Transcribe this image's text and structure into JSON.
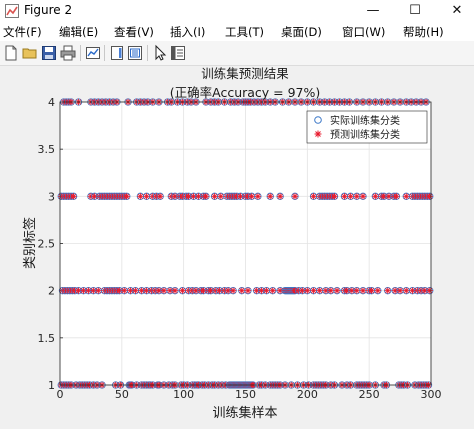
{
  "window": {
    "title": "Figure 2",
    "minimize_icon": "minimize-icon",
    "maximize_icon": "maximize-icon",
    "close_icon": "close-icon"
  },
  "menu": {
    "items": [
      {
        "label": "文件(F)"
      },
      {
        "label": "编辑(E)"
      },
      {
        "label": "查看(V)"
      },
      {
        "label": "插入(I)"
      },
      {
        "label": "工具(T)"
      },
      {
        "label": "桌面(D)"
      },
      {
        "label": "窗口(W)"
      },
      {
        "label": "帮助(H)"
      }
    ]
  },
  "toolbar": {
    "icons": [
      "new-figure-icon",
      "open-file-icon",
      "save-icon",
      "print-icon",
      "link-plot-icon",
      "colorbar-icon",
      "legend-icon",
      "pointer-icon",
      "property-editor-icon"
    ]
  },
  "colors": {
    "actual": "#3c78c8",
    "predicted": "#e8192c"
  },
  "chart_data": {
    "type": "scatter",
    "title": "训练集预测结果",
    "subtitle": "(正确率Accuracy = 97%)",
    "xlabel": "训练集样本",
    "ylabel": "类别标签",
    "xlim": [
      0,
      300
    ],
    "ylim": [
      1,
      4
    ],
    "xticks": [
      0,
      50,
      100,
      150,
      200,
      250,
      300
    ],
    "yticks": [
      1,
      1.5,
      2,
      2.5,
      3,
      3.5,
      4
    ],
    "grid": true,
    "legend_position": "top-right",
    "series": [
      {
        "name": "实际训练集分类",
        "marker": "o"
      },
      {
        "name": "预测训练集分类",
        "marker": "*"
      }
    ],
    "points": [
      {
        "x": [
          1,
          3,
          5,
          7,
          9,
          13,
          16,
          18,
          20,
          22,
          24,
          27,
          30,
          34,
          45,
          49,
          56,
          57,
          58,
          62,
          66,
          68,
          70,
          72,
          73,
          75,
          79,
          80,
          84,
          88,
          91,
          93,
          98,
          100,
          103,
          107,
          109,
          111,
          112,
          115,
          117,
          120,
          123,
          125,
          128,
          131,
          134,
          137,
          138,
          139,
          140,
          141,
          142,
          143,
          144,
          145,
          146,
          147,
          148,
          149,
          150,
          151,
          152,
          153,
          154,
          155,
          156,
          161,
          163,
          166,
          170,
          172,
          174,
          176,
          178,
          182,
          187,
          192,
          197,
          201,
          205,
          207,
          209,
          211,
          213,
          215,
          219,
          222,
          228,
          232,
          235,
          240,
          242,
          244,
          246,
          248,
          250,
          255,
          262,
          264,
          274,
          276,
          278,
          281,
          287,
          290,
          292,
          294,
          296,
          298
        ],
        "y": 1
      },
      {
        "x": [
          2,
          4,
          6,
          8,
          10,
          12,
          15,
          19,
          23,
          27,
          31,
          36,
          38,
          40,
          42,
          44,
          46,
          48,
          52,
          57,
          61,
          66,
          70,
          74,
          77,
          80,
          84,
          89,
          93,
          99,
          104,
          107,
          110,
          114,
          116,
          120,
          122,
          126,
          129,
          133,
          136,
          140,
          147,
          152,
          159,
          163,
          167,
          172,
          178,
          182,
          183,
          184,
          185,
          186,
          187,
          188,
          189,
          190,
          193,
          196,
          200,
          205,
          210,
          215,
          219,
          224,
          230,
          232,
          236,
          240,
          245,
          250,
          252,
          257,
          265,
          271,
          275,
          280,
          285,
          289,
          292,
          295,
          299
        ],
        "y": 2
      },
      {
        "x": [
          1,
          3,
          5,
          7,
          9,
          11,
          25,
          28,
          32,
          34,
          36,
          38,
          40,
          42,
          44,
          46,
          48,
          50,
          52,
          54,
          65,
          70,
          75,
          78,
          81,
          90,
          93,
          97,
          99,
          102,
          104,
          108,
          112,
          116,
          118,
          125,
          130,
          135,
          137,
          139,
          141,
          143,
          146,
          150,
          152,
          155,
          160,
          170,
          178,
          190,
          205,
          210,
          212,
          214,
          216,
          218,
          220,
          222,
          230,
          235,
          240,
          245,
          255,
          260,
          262,
          266,
          270,
          272,
          280,
          285,
          287,
          289,
          291,
          293,
          295,
          297,
          299
        ],
        "y": 3
      },
      {
        "x": [
          3,
          5,
          7,
          9,
          15,
          25,
          28,
          31,
          34,
          37,
          40,
          43,
          46,
          55,
          62,
          65,
          68,
          71,
          75,
          80,
          87,
          90,
          95,
          99,
          103,
          106,
          110,
          118,
          122,
          125,
          128,
          133,
          138,
          141,
          144,
          148,
          150,
          152,
          154,
          157,
          160,
          163,
          166,
          170,
          174,
          180,
          185,
          190,
          195,
          200,
          205,
          210,
          214,
          218,
          222,
          226,
          230,
          234,
          240,
          245,
          250,
          255,
          260,
          265,
          270,
          275,
          280,
          284,
          288,
          292,
          296
        ],
        "y": 4
      }
    ]
  }
}
